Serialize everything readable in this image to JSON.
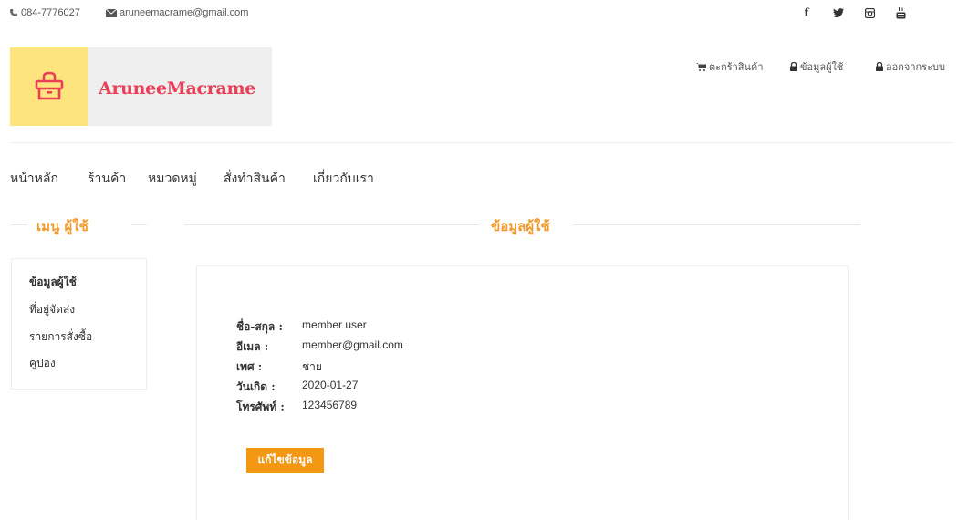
{
  "topbar": {
    "phone": "084-7776027",
    "email": "aruneemacrame@gmail.com",
    "social": {
      "facebook": "f",
      "twitter_icon": "twitter-icon",
      "instagram_icon": "instagram-icon",
      "youtube_icon": "youtube-icon"
    }
  },
  "brand": {
    "name": "AruneeMacrame",
    "logo_icon": "shopping-bag-icon",
    "logo_color": "#e93f57",
    "logo_bg": "#fde47f"
  },
  "account": {
    "cart": "ตะกร้าสินค้า",
    "user_info": "ข้อมูลผู้ใช้",
    "logout": "ออกจากระบบ"
  },
  "nav": {
    "home": "หน้าหลัก",
    "shop": "ร้านค้า",
    "category": "หมวดหมู่",
    "custom_order": "สั่งทำสินค้า",
    "about": "เกี่ยวกับเรา"
  },
  "sidebar": {
    "title": "เมนู ผู้ใช้",
    "items": [
      {
        "label": "ข้อมูลผู้ใช้"
      },
      {
        "label": "ที่อยู่จัดส่ง"
      },
      {
        "label": "รายการสั่งซื้อ"
      },
      {
        "label": "คูปอง"
      }
    ]
  },
  "profile": {
    "title": "ข้อมูลผู้ใช้",
    "fields": [
      {
        "label": "ชื่อ-สกุล :",
        "value": "member user"
      },
      {
        "label": "อีเมล :",
        "value": "member@gmail.com"
      },
      {
        "label": "เพศ :",
        "value": "ชาย"
      },
      {
        "label": "วันเกิด :",
        "value": "2020-01-27"
      },
      {
        "label": "โทรศัพท์ :",
        "value": "123456789"
      }
    ],
    "edit_button": "แก้ไขข้อมูล"
  },
  "colors": {
    "accent": "#f29a2e",
    "button": "#f49712"
  }
}
